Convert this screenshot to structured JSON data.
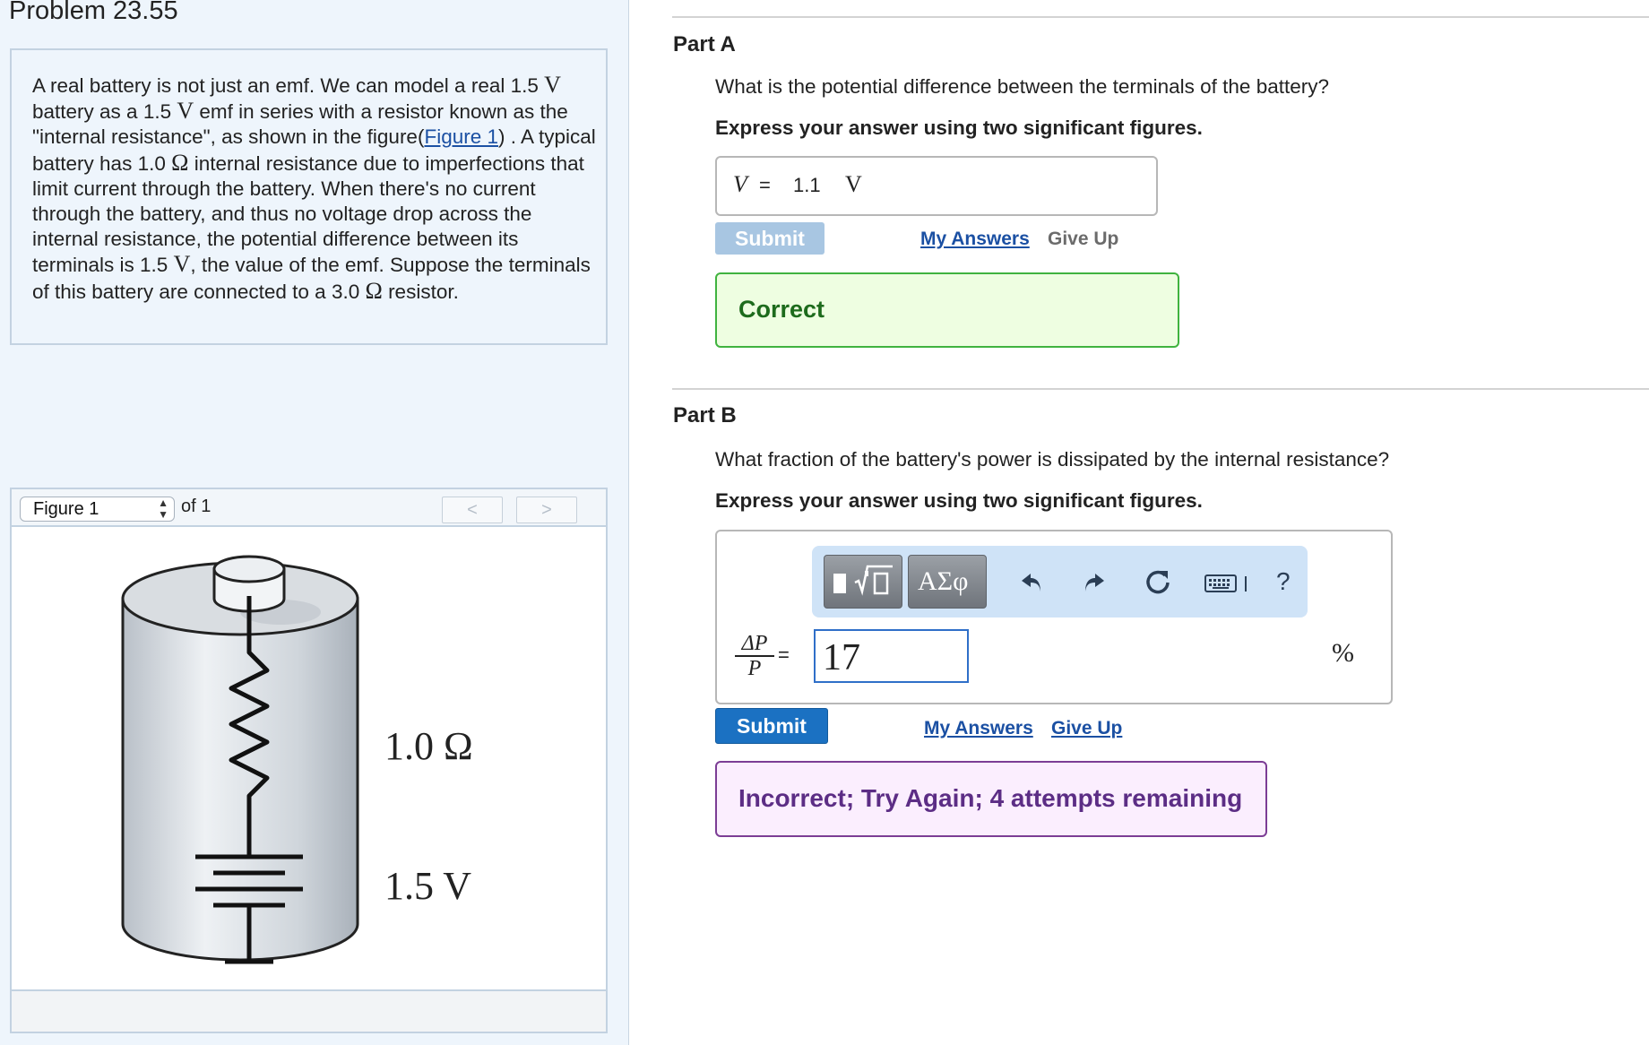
{
  "problem": {
    "title": "Problem 23.55",
    "text": {
      "t1": "A real battery is not just an emf. We can model a real 1.5 ",
      "v1": "V",
      "t2": "battery as a 1.5 ",
      "v2": "V",
      "t3": " emf in series with a resistor known as the \"internal resistance\", as shown in the figure(",
      "figure_link": "Figure 1",
      "t4": ") . A typical battery has 1.0 ",
      "ohm1": "Ω",
      "t5": " internal resistance due to imperfections that limit current through the battery. When there's no current through the battery, and thus no voltage drop across the internal resistance, the potential difference between its terminals is 1.5 ",
      "v3": "V",
      "t6": ", the value of the emf. Suppose the terminals of this battery are connected to a 3.0 ",
      "ohm2": "Ω",
      "t7": " resistor."
    }
  },
  "figure": {
    "selector_value": "Figure 1",
    "of_label": "of 1",
    "prev_label": "<",
    "next_label": ">",
    "resistance_label": "1.0 Ω",
    "emf_label": "1.5 V"
  },
  "part_a": {
    "label": "Part A",
    "question": "What is the potential difference between the terminals of the battery?",
    "instruction": "Express your answer using two significant figures.",
    "variable": "V",
    "equals": "=",
    "answer": "1.1",
    "unit": "V",
    "submit": "Submit",
    "my_answers": "My Answers",
    "give_up": "Give Up",
    "feedback": "Correct"
  },
  "part_b": {
    "label": "Part B",
    "question": "What fraction of the battery's power is dissipated by the internal resistance?",
    "instruction": "Express your answer using two significant figures.",
    "frac_num": "ΔP",
    "frac_den": "P",
    "equals": "=",
    "answer": "17",
    "unit": "%",
    "toolbar": {
      "templates_icon": "fraction-sqrt-template-icon",
      "symbols_label": "ΑΣφ",
      "undo_icon": "undo-icon",
      "redo_icon": "redo-icon",
      "reset_icon": "reset-icon",
      "keyboard_icon": "keyboard-icon",
      "help_label": "?"
    },
    "submit": "Submit",
    "my_answers": "My Answers",
    "give_up": "Give Up",
    "feedback": "Incorrect; Try Again; 4 attempts remaining"
  },
  "colors": {
    "left_panel_bg": "#eef5fc",
    "correct_border": "#40b33f",
    "correct_bg": "#eefee1",
    "incorrect_border": "#7c3d95",
    "incorrect_bg": "#fbeefe",
    "submit_active": "#1b71c2",
    "submit_disabled": "#a8c6e2",
    "link": "#1b50a3"
  }
}
